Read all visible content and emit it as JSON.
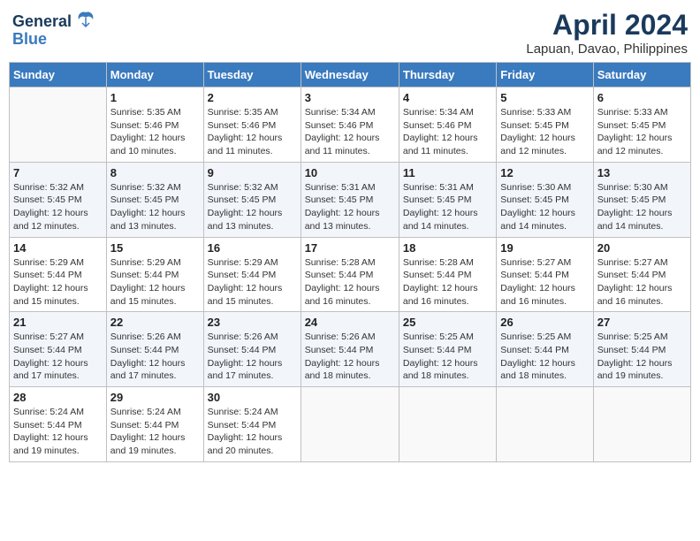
{
  "header": {
    "logo_line1": "General",
    "logo_line2": "Blue",
    "title": "April 2024",
    "subtitle": "Lapuan, Davao, Philippines"
  },
  "days_of_week": [
    "Sunday",
    "Monday",
    "Tuesday",
    "Wednesday",
    "Thursday",
    "Friday",
    "Saturday"
  ],
  "weeks": [
    [
      {
        "day": "",
        "info": ""
      },
      {
        "day": "1",
        "info": "Sunrise: 5:35 AM\nSunset: 5:46 PM\nDaylight: 12 hours\nand 10 minutes."
      },
      {
        "day": "2",
        "info": "Sunrise: 5:35 AM\nSunset: 5:46 PM\nDaylight: 12 hours\nand 11 minutes."
      },
      {
        "day": "3",
        "info": "Sunrise: 5:34 AM\nSunset: 5:46 PM\nDaylight: 12 hours\nand 11 minutes."
      },
      {
        "day": "4",
        "info": "Sunrise: 5:34 AM\nSunset: 5:46 PM\nDaylight: 12 hours\nand 11 minutes."
      },
      {
        "day": "5",
        "info": "Sunrise: 5:33 AM\nSunset: 5:45 PM\nDaylight: 12 hours\nand 12 minutes."
      },
      {
        "day": "6",
        "info": "Sunrise: 5:33 AM\nSunset: 5:45 PM\nDaylight: 12 hours\nand 12 minutes."
      }
    ],
    [
      {
        "day": "7",
        "info": "Sunrise: 5:32 AM\nSunset: 5:45 PM\nDaylight: 12 hours\nand 12 minutes."
      },
      {
        "day": "8",
        "info": "Sunrise: 5:32 AM\nSunset: 5:45 PM\nDaylight: 12 hours\nand 13 minutes."
      },
      {
        "day": "9",
        "info": "Sunrise: 5:32 AM\nSunset: 5:45 PM\nDaylight: 12 hours\nand 13 minutes."
      },
      {
        "day": "10",
        "info": "Sunrise: 5:31 AM\nSunset: 5:45 PM\nDaylight: 12 hours\nand 13 minutes."
      },
      {
        "day": "11",
        "info": "Sunrise: 5:31 AM\nSunset: 5:45 PM\nDaylight: 12 hours\nand 14 minutes."
      },
      {
        "day": "12",
        "info": "Sunrise: 5:30 AM\nSunset: 5:45 PM\nDaylight: 12 hours\nand 14 minutes."
      },
      {
        "day": "13",
        "info": "Sunrise: 5:30 AM\nSunset: 5:45 PM\nDaylight: 12 hours\nand 14 minutes."
      }
    ],
    [
      {
        "day": "14",
        "info": "Sunrise: 5:29 AM\nSunset: 5:44 PM\nDaylight: 12 hours\nand 15 minutes."
      },
      {
        "day": "15",
        "info": "Sunrise: 5:29 AM\nSunset: 5:44 PM\nDaylight: 12 hours\nand 15 minutes."
      },
      {
        "day": "16",
        "info": "Sunrise: 5:29 AM\nSunset: 5:44 PM\nDaylight: 12 hours\nand 15 minutes."
      },
      {
        "day": "17",
        "info": "Sunrise: 5:28 AM\nSunset: 5:44 PM\nDaylight: 12 hours\nand 16 minutes."
      },
      {
        "day": "18",
        "info": "Sunrise: 5:28 AM\nSunset: 5:44 PM\nDaylight: 12 hours\nand 16 minutes."
      },
      {
        "day": "19",
        "info": "Sunrise: 5:27 AM\nSunset: 5:44 PM\nDaylight: 12 hours\nand 16 minutes."
      },
      {
        "day": "20",
        "info": "Sunrise: 5:27 AM\nSunset: 5:44 PM\nDaylight: 12 hours\nand 16 minutes."
      }
    ],
    [
      {
        "day": "21",
        "info": "Sunrise: 5:27 AM\nSunset: 5:44 PM\nDaylight: 12 hours\nand 17 minutes."
      },
      {
        "day": "22",
        "info": "Sunrise: 5:26 AM\nSunset: 5:44 PM\nDaylight: 12 hours\nand 17 minutes."
      },
      {
        "day": "23",
        "info": "Sunrise: 5:26 AM\nSunset: 5:44 PM\nDaylight: 12 hours\nand 17 minutes."
      },
      {
        "day": "24",
        "info": "Sunrise: 5:26 AM\nSunset: 5:44 PM\nDaylight: 12 hours\nand 18 minutes."
      },
      {
        "day": "25",
        "info": "Sunrise: 5:25 AM\nSunset: 5:44 PM\nDaylight: 12 hours\nand 18 minutes."
      },
      {
        "day": "26",
        "info": "Sunrise: 5:25 AM\nSunset: 5:44 PM\nDaylight: 12 hours\nand 18 minutes."
      },
      {
        "day": "27",
        "info": "Sunrise: 5:25 AM\nSunset: 5:44 PM\nDaylight: 12 hours\nand 19 minutes."
      }
    ],
    [
      {
        "day": "28",
        "info": "Sunrise: 5:24 AM\nSunset: 5:44 PM\nDaylight: 12 hours\nand 19 minutes."
      },
      {
        "day": "29",
        "info": "Sunrise: 5:24 AM\nSunset: 5:44 PM\nDaylight: 12 hours\nand 19 minutes."
      },
      {
        "day": "30",
        "info": "Sunrise: 5:24 AM\nSunset: 5:44 PM\nDaylight: 12 hours\nand 20 minutes."
      },
      {
        "day": "",
        "info": ""
      },
      {
        "day": "",
        "info": ""
      },
      {
        "day": "",
        "info": ""
      },
      {
        "day": "",
        "info": ""
      }
    ]
  ]
}
